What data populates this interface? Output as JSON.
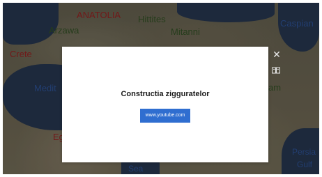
{
  "map": {
    "labels": {
      "anatolia": "ANATOLIA",
      "hittites": "Hittites",
      "arzawa": "Arzawa",
      "mitanni": "Mitanni",
      "caspian": "Caspian",
      "crete": "Crete",
      "medit": "Medit",
      "eg": "Eg",
      "am": "am",
      "sea": "Sea",
      "persian": "Persia",
      "gulf": "Gulf"
    },
    "colors": {
      "region_label": "#8a1f1f",
      "people_label": "#2e4a22",
      "water_label": "#2a4c8a"
    }
  },
  "modal": {
    "title": "Constructia zigguratelor",
    "link_label": "www.youtube.com",
    "close_icon": "close-icon",
    "side_icon": "book-icon",
    "accent_color": "#2f6ed0"
  }
}
